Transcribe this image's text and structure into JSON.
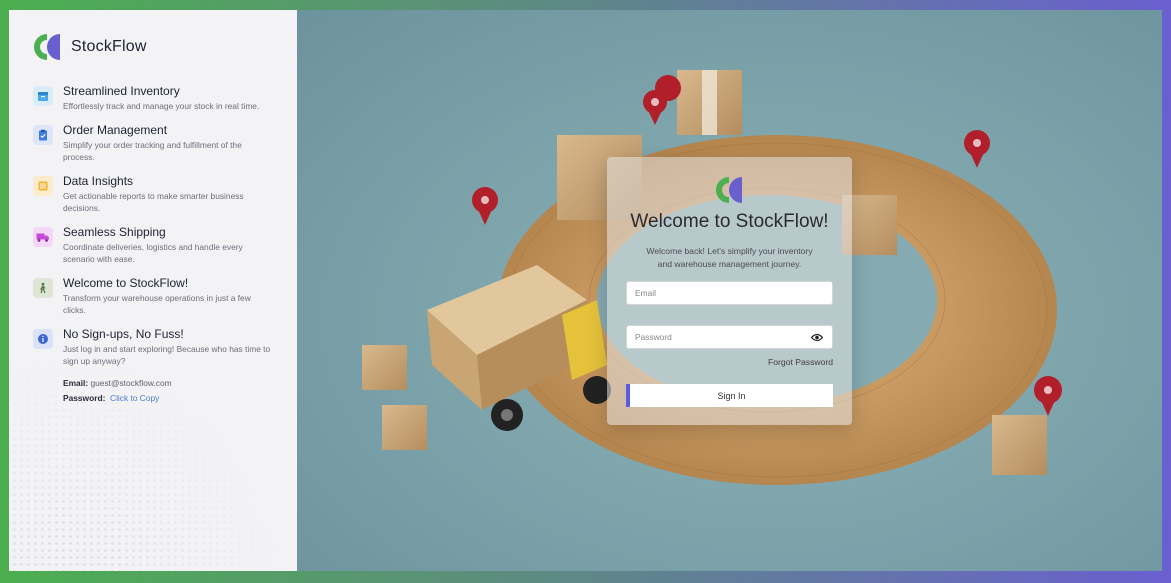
{
  "brand": {
    "name": "StockFlow"
  },
  "features": [
    {
      "title": "Streamlined Inventory",
      "desc": "Effortlessly track and manage your stock in real time.",
      "icon": "inventory-box-icon",
      "color": "#4aa8e8"
    },
    {
      "title": "Order Management",
      "desc": "Simplify your order tracking and fulfillment of the process.",
      "icon": "clipboard-check-icon",
      "color": "#3d7be0"
    },
    {
      "title": "Data Insights",
      "desc": "Get actionable reports to make smarter business decisions.",
      "icon": "database-icon",
      "color": "#f2b233"
    },
    {
      "title": "Seamless Shipping",
      "desc": "Coordinate deliveries, logistics and handle every scenario with ease.",
      "icon": "truck-icon",
      "color": "#c84ad9"
    },
    {
      "title": "Welcome to StockFlow!",
      "desc": "Transform your warehouse operations in just a few clicks.",
      "icon": "worker-icon",
      "color": "#5c7a45"
    },
    {
      "title": "No Sign-ups, No Fuss!",
      "desc": "Just log in and start exploring! Because who has time to sign up anyway?",
      "icon": "info-icon",
      "color": "#3d64d6"
    }
  ],
  "credentials": {
    "email_label": "Email:",
    "email_value": "guest@stockflow.com",
    "password_label": "Password:",
    "password_link": "Click to Copy"
  },
  "login": {
    "title": "Welcome to StockFlow!",
    "subtitle_line1": "Welcome back! Let's simplify your inventory",
    "subtitle_line2": "and warehouse management journey.",
    "email_placeholder": "Email",
    "password_placeholder": "Password",
    "forgot_label": "Forgot Password",
    "signin_label": "Sign In"
  },
  "colors": {
    "logo_green": "#4caf50",
    "logo_purple": "#6a5fcf",
    "accent": "#5b5ce0"
  }
}
